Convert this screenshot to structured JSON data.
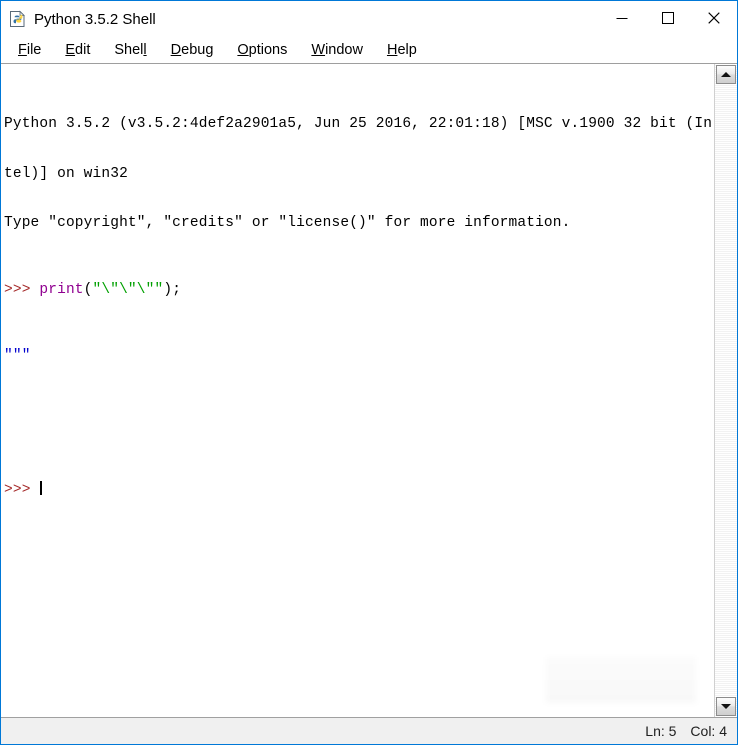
{
  "window": {
    "title": "Python 3.5.2 Shell",
    "icon": "python-file-icon",
    "border_color": "#0078d7",
    "caption": {
      "minimize_label": "Minimize",
      "maximize_label": "Maximize",
      "close_label": "Close"
    }
  },
  "menubar": {
    "items": [
      {
        "label": "File",
        "before": "",
        "accel": "F",
        "after": "ile"
      },
      {
        "label": "Edit",
        "before": "",
        "accel": "E",
        "after": "dit"
      },
      {
        "label": "Shell",
        "before": "Shel",
        "accel": "l",
        "after": ""
      },
      {
        "label": "Debug",
        "before": "",
        "accel": "D",
        "after": "ebug"
      },
      {
        "label": "Options",
        "before": "",
        "accel": "O",
        "after": "ptions"
      },
      {
        "label": "Window",
        "before": "",
        "accel": "W",
        "after": "indow"
      },
      {
        "label": "Help",
        "before": "",
        "accel": "H",
        "after": "elp"
      }
    ]
  },
  "shell": {
    "banner": [
      "Python 3.5.2 (v3.5.2:4def2a2901a5, Jun 25 2016, 22:01:18) [MSC v.1900 32 bit (In",
      "tel)] on win32",
      "Type \"copyright\", \"credits\" or \"license()\" for more information."
    ],
    "entry": {
      "prompt": ">>> ",
      "code_builtin": "print",
      "code_open_paren": "(",
      "code_string": "\"\\\"\\\"\\\"\"",
      "code_close": ");"
    },
    "output": "\"\"\"",
    "current_prompt": ">>> ",
    "colors": {
      "prompt": "#a52a2a",
      "builtin": "#900090",
      "string": "#00a000",
      "output": "#0000cd",
      "plain": "#000000",
      "background": "#ffffff"
    }
  },
  "scrollbar": {
    "up_arrow": "scroll-up-arrow-icon",
    "down_arrow": "scroll-down-arrow-icon"
  },
  "statusbar": {
    "line_label": "Ln: 5",
    "col_label": "Col: 4"
  }
}
